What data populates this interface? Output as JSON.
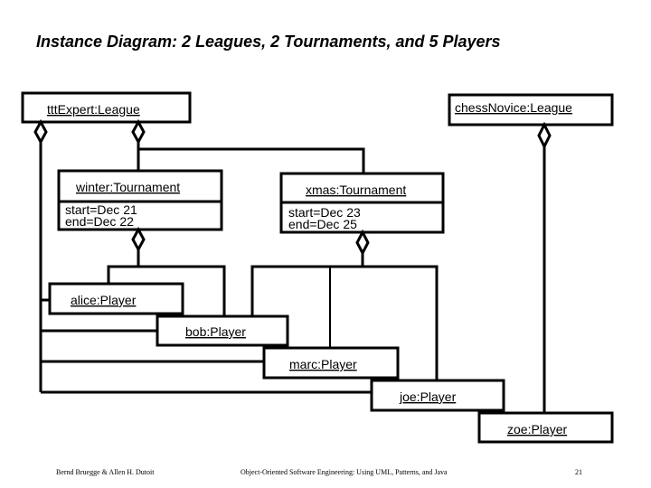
{
  "title": "Instance Diagram: 2 Leagues, 2 Tournaments, and 5 Players",
  "leagues": [
    {
      "name": "tttExpert:League"
    },
    {
      "name": "chessNovice:League"
    }
  ],
  "tournaments": [
    {
      "name": "winter:Tournament",
      "attributes": [
        "start=Dec 21",
        "end=Dec 22"
      ]
    },
    {
      "name": "xmas:Tournament",
      "attributes": [
        "start=Dec 23",
        "end=Dec 25"
      ]
    }
  ],
  "players": [
    {
      "name": "alice:Player"
    },
    {
      "name": "bob:Player"
    },
    {
      "name": "marc:Player"
    },
    {
      "name": "joe:Player"
    },
    {
      "name": "zoe:Player"
    }
  ],
  "associations": [
    {
      "from": "tttExpert:League",
      "to": "winter:Tournament",
      "kind": "aggregation"
    },
    {
      "from": "tttExpert:League",
      "to": "xmas:Tournament",
      "kind": "aggregation"
    },
    {
      "from": "tttExpert:League",
      "to": [
        "alice:Player",
        "bob:Player",
        "marc:Player",
        "joe:Player"
      ],
      "kind": "aggregation"
    },
    {
      "from": "chessNovice:League",
      "to": [
        "zoe:Player"
      ],
      "kind": "aggregation"
    },
    {
      "from": "winter:Tournament",
      "to": [
        "alice:Player",
        "bob:Player"
      ],
      "kind": "aggregation"
    },
    {
      "from": "xmas:Tournament",
      "to": [
        "bob:Player",
        "marc:Player",
        "joe:Player"
      ],
      "kind": "aggregation"
    }
  ],
  "footer": {
    "authors": "Bernd Bruegge & Allen H. Dutoit",
    "book": "Object-Oriented Software Engineering: Using UML, Patterns, and Java",
    "page": "21"
  }
}
